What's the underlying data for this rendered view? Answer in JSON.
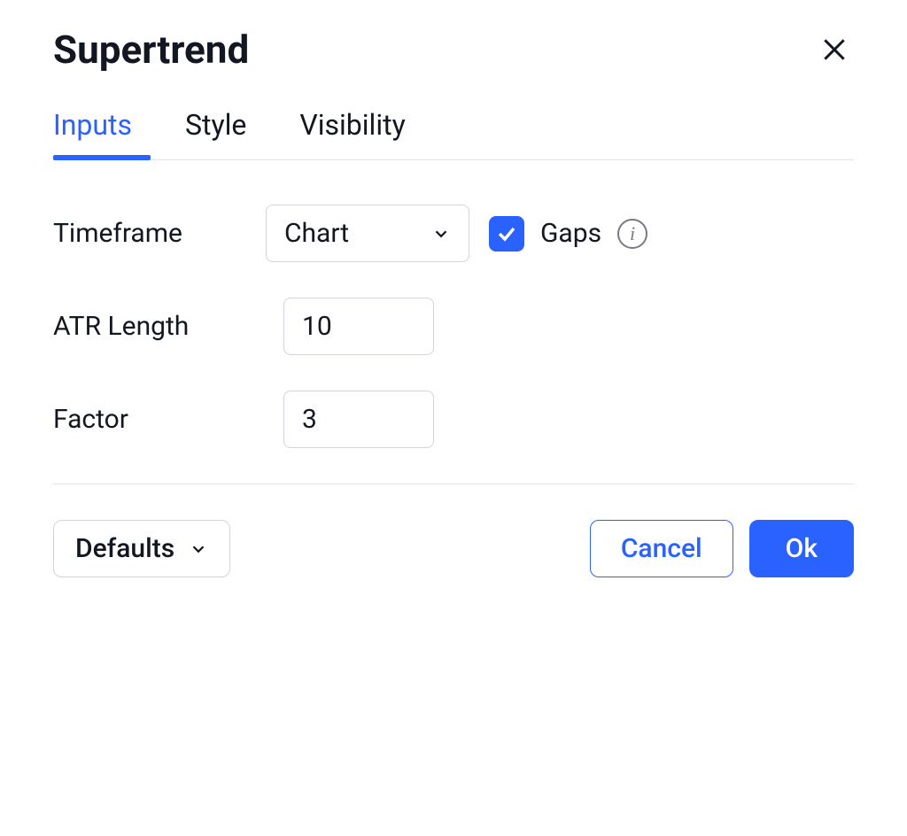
{
  "title": "Supertrend",
  "tabs": {
    "inputs": "Inputs",
    "style": "Style",
    "visibility": "Visibility"
  },
  "form": {
    "timeframe_label": "Timeframe",
    "timeframe_value": "Chart",
    "gaps_label": "Gaps",
    "gaps_checked": true,
    "atr_length_label": "ATR Length",
    "atr_length_value": "10",
    "factor_label": "Factor",
    "factor_value": "3"
  },
  "footer": {
    "defaults": "Defaults",
    "cancel": "Cancel",
    "ok": "Ok"
  }
}
